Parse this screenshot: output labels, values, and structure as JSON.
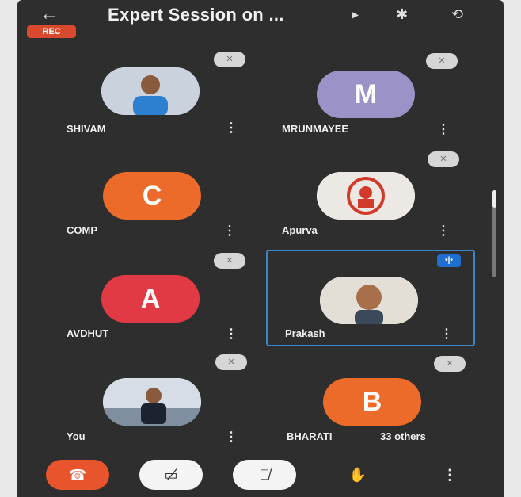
{
  "topbar": {
    "back_icon": "←",
    "title": "Expert Session on ...",
    "icons": [
      "▸",
      "✱",
      "⟲"
    ]
  },
  "rec_badge": "REC",
  "participants": [
    {
      "name": "SHIVAM",
      "initial": "",
      "color": "#d8dbe3",
      "photo": true
    },
    {
      "name": "MRUNMAYEE",
      "initial": "M",
      "color": "#9b93c8",
      "photo": false
    },
    {
      "name": "COMP",
      "initial": "C",
      "color": "#ec6a2a",
      "photo": false
    },
    {
      "name": "Apurva",
      "initial": "",
      "color": "#e9e6e3",
      "photo": true
    },
    {
      "name": "AVDHUT",
      "initial": "A",
      "color": "#e23a44",
      "photo": false
    },
    {
      "name": "Prakash",
      "initial": "",
      "color": "#e8e4de",
      "photo": true
    },
    {
      "name": "You",
      "initial": "",
      "color": "#dfe3ea",
      "photo": true
    },
    {
      "name": "BHARATI",
      "initial": "B",
      "color": "#ec6a2a",
      "photo": false
    }
  ],
  "others_label": "33 others",
  "speaking_indicator": "•|•",
  "controls": {
    "end_call": "☎",
    "camera": "▭̸",
    "mic": "🎙̸",
    "hand": "✋",
    "more": "⋮"
  },
  "colors": {
    "end_call": "#e8542c",
    "control_bg": "#f4f4f4",
    "active_border": "#3a84c9"
  }
}
